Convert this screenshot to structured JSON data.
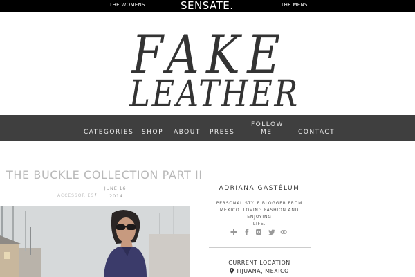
{
  "topbar": {
    "left_link": "THE WOMENS",
    "brand": "SENSATE.",
    "right_link": "THE MENS"
  },
  "logo": {
    "line1": "FAKE",
    "line2": "LEATHER"
  },
  "nav": {
    "items": [
      "CATEGORIES",
      "SHOP",
      "ABOUT",
      "PRESS",
      "FOLLOW",
      "ME",
      "CONTACT"
    ]
  },
  "post": {
    "title": "THE BUCKLE COLLECTION PART II",
    "category": "ACCESSORIES",
    "separator": "/",
    "date_line1": "JUNE 16,",
    "date_line2": "2014"
  },
  "sidebar": {
    "name": "ADRIANA GASTÉLUM",
    "bio_line1": "PERSONAL STYLE BLOGGER FROM",
    "bio_line2": "MEXICO. LOVING FASHION AND ENJOYING",
    "bio_line3": "LIFE.",
    "social_icons": [
      "plus-icon",
      "facebook-icon",
      "instagram-icon",
      "twitter-icon",
      "bloglovin-icon"
    ],
    "location_label": "CURRENT LOCATION",
    "location": "TIJUANA, MEXICO"
  },
  "colors": {
    "topbar": "#000000",
    "nav": "#3f3f3f",
    "title": "#b8b8b8"
  }
}
